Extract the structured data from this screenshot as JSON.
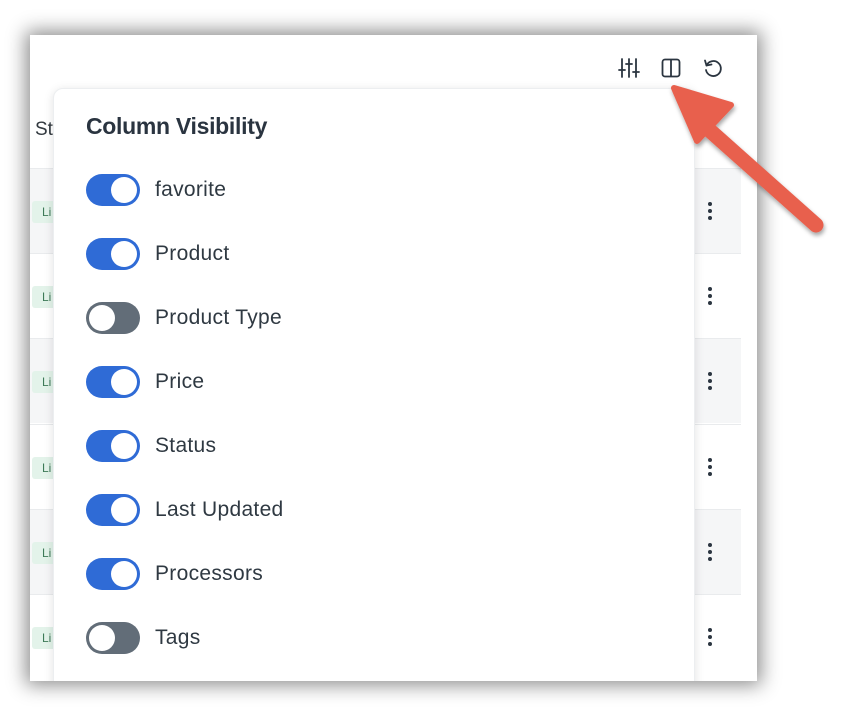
{
  "table": {
    "header_fragment": "St",
    "badge_fragment": "Li",
    "rows": [
      {
        "badge": "Li"
      },
      {
        "badge": "Li"
      },
      {
        "badge": "Li"
      },
      {
        "badge": "Li"
      },
      {
        "badge": "Li"
      },
      {
        "badge": "Li"
      }
    ]
  },
  "toolbar": {
    "icons": [
      "sliders-icon",
      "columns-icon",
      "reset-icon"
    ]
  },
  "popover": {
    "title": "Column Visibility",
    "columns": [
      {
        "label": "favorite",
        "visible": true
      },
      {
        "label": "Product",
        "visible": true
      },
      {
        "label": "Product Type",
        "visible": false
      },
      {
        "label": "Price",
        "visible": true
      },
      {
        "label": "Status",
        "visible": true
      },
      {
        "label": "Last Updated",
        "visible": true
      },
      {
        "label": "Processors",
        "visible": true
      },
      {
        "label": "Tags",
        "visible": false
      }
    ]
  },
  "colors": {
    "toggle_on": "#2f6bd6",
    "toggle_off": "#626d78",
    "annotation_arrow": "#e8604e"
  }
}
